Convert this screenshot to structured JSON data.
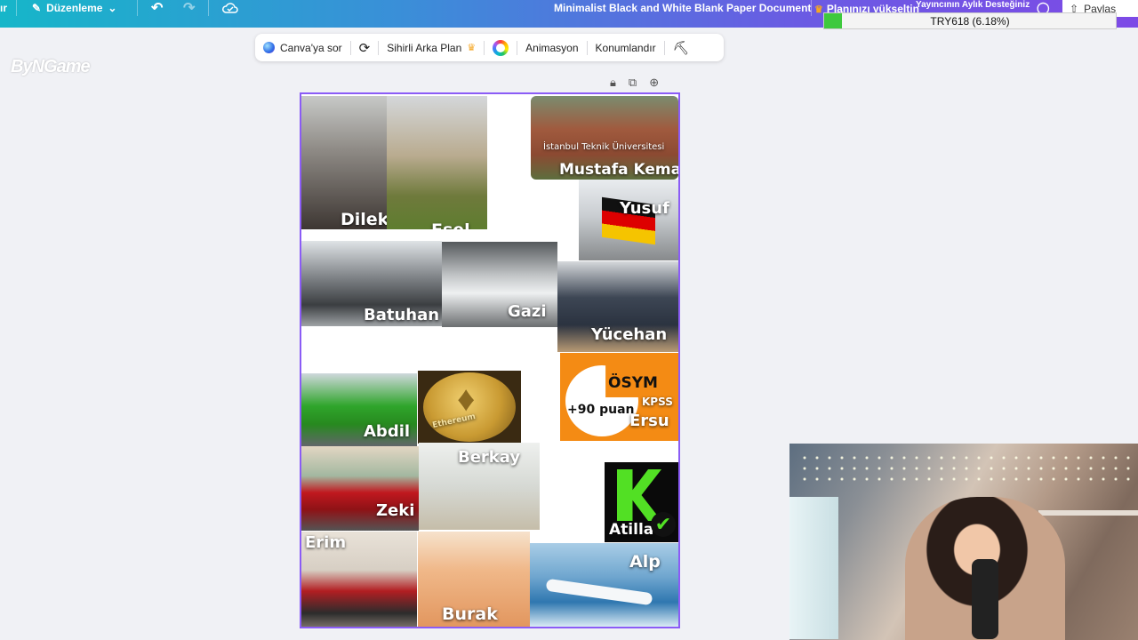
{
  "topbar": {
    "left_fragment": "ır",
    "edit_label": "Düzenleme",
    "doc_title": "Minimalist Black and White Blank Paper Document",
    "upgrade_label": "Planınızı yükseltin",
    "share_label": "Paylaş",
    "donation_title": "Yayıncının Aylık Desteğiniz",
    "donation_progress_text": "TRY618 (6.18%)",
    "donation_progress_value": 6.18
  },
  "toolbar": {
    "ask_canva": "Canva'ya sor",
    "magic_bg": "Sihirli Arka Plan",
    "animation": "Animasyon",
    "position": "Konumlandır"
  },
  "watermark": "ByNGame",
  "tiles": [
    {
      "name": "Dilek"
    },
    {
      "name": "Esel"
    },
    {
      "name": "Mustafa Kemal",
      "caption": "İstanbul Teknik Üniversitesi"
    },
    {
      "name": "Yusuf"
    },
    {
      "name": "Batuhan"
    },
    {
      "name": "Gazi"
    },
    {
      "name": "Yücehan"
    },
    {
      "name": "Abdil"
    },
    {
      "name": "Ethereum"
    },
    {
      "name": "Ersu",
      "brand": "ÖSYM",
      "sub": "KPSS",
      "score": "+90 puan"
    },
    {
      "name": "Zeki"
    },
    {
      "name": "Berkay"
    },
    {
      "name": "Atilla"
    },
    {
      "name": "Erim"
    },
    {
      "name": "Burak"
    },
    {
      "name": "Alp"
    }
  ]
}
